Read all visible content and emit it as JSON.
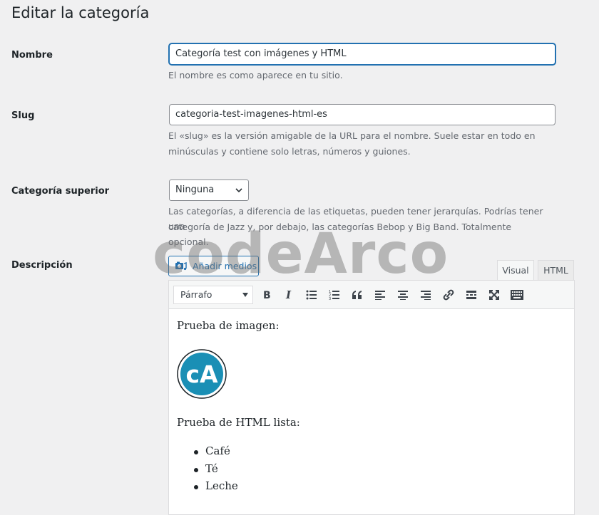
{
  "page_title": "Editar la categoría",
  "name_row": {
    "label": "Nombre",
    "value": "Categoría test con imágenes y HTML",
    "help": "El nombre es como aparece en tu sitio."
  },
  "slug_row": {
    "label": "Slug",
    "value": "categoria-test-imagenes-html-es",
    "help_line1": "El «slug» es la versión amigable de la URL para el nombre. Suele estar en todo en",
    "help_line2": "minúsculas y contiene solo letras, números y guiones."
  },
  "parent_row": {
    "label": "Categoría superior",
    "selected": "Ninguna",
    "help_line1": "Las categorías, a diferencia de las etiquetas, pueden tener jerarquías. Podrías tener una",
    "help_line2": "categoría de Jazz y, por debajo, las categorías Bebop y Big Band. Totalmente opcional."
  },
  "description_row": {
    "label": "Descripción",
    "add_media_label": "Añadir medios",
    "tabs": [
      "Visual",
      "HTML"
    ],
    "active_tab": "Visual",
    "format_selected": "Párrafo",
    "toolbar_icons": [
      "bold-icon",
      "italic-icon",
      "bullet-list-icon",
      "numbered-list-icon",
      "blockquote-icon",
      "align-left-icon",
      "align-center-icon",
      "align-right-icon",
      "link-icon",
      "read-more-icon",
      "fullscreen-icon",
      "toolbar-toggle-icon"
    ],
    "content": {
      "para1": "Prueba de imagen:",
      "logo_text": "cA",
      "para2": "Prueba de HTML lista:",
      "list": [
        "Café",
        "Té",
        "Leche"
      ]
    }
  },
  "watermark": "codeArco",
  "colors": {
    "accent": "#2271b1",
    "logo": "#1a8fb5"
  }
}
